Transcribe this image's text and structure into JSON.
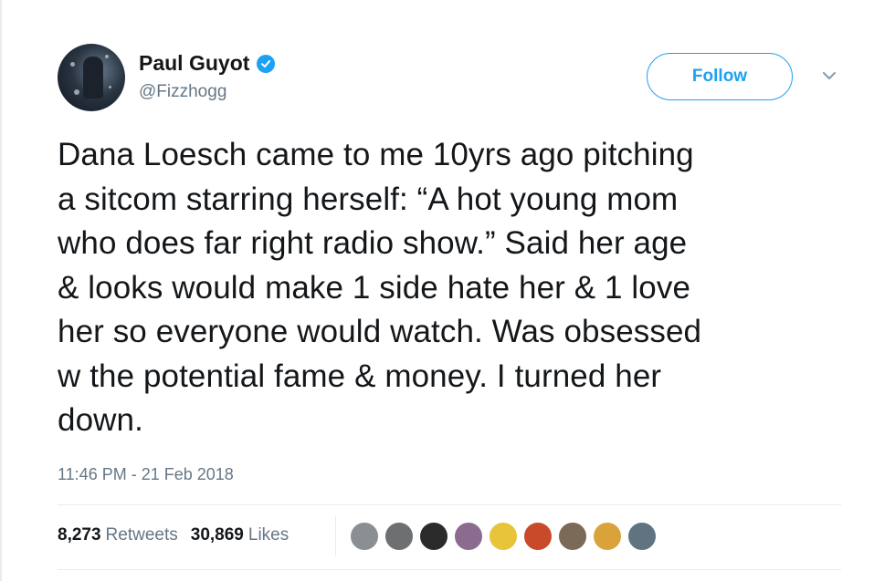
{
  "author": {
    "name": "Paul Guyot",
    "handle": "@Fizzhogg",
    "verified": true
  },
  "follow_button": {
    "label": "Follow"
  },
  "tweet": {
    "lines": [
      "Dana Loesch came to me 10yrs ago pitching",
      "a sitcom starring herself: “A hot young mom",
      "who does far right radio show.” Said her age",
      "& looks would make 1 side hate her & 1 love",
      "her so everyone would watch. Was obsessed",
      "w the potential fame & money. I turned her",
      "down."
    ],
    "timestamp": "11:46 PM - 21 Feb 2018"
  },
  "stats": {
    "retweets_count": "8,273",
    "retweets_label": "Retweets",
    "likes_count": "30,869",
    "likes_label": "Likes"
  },
  "likers": [
    {
      "name": "liker-avatar-1",
      "color": "#8a8f94"
    },
    {
      "name": "liker-avatar-2",
      "color": "#6d6f70"
    },
    {
      "name": "liker-avatar-3",
      "color": "#2b2b2b"
    },
    {
      "name": "liker-avatar-4",
      "color": "#8b6b8e"
    },
    {
      "name": "liker-avatar-5",
      "color": "#e8c43a"
    },
    {
      "name": "liker-avatar-6",
      "color": "#c94a2a"
    },
    {
      "name": "liker-avatar-7",
      "color": "#7b6a55"
    },
    {
      "name": "liker-avatar-8",
      "color": "#d9a23b"
    },
    {
      "name": "liker-avatar-9",
      "color": "#5f7480"
    }
  ],
  "colors": {
    "accent": "#1da1f2",
    "text": "#14171a",
    "secondary_text": "#657786",
    "divider": "#e6ecf0"
  }
}
